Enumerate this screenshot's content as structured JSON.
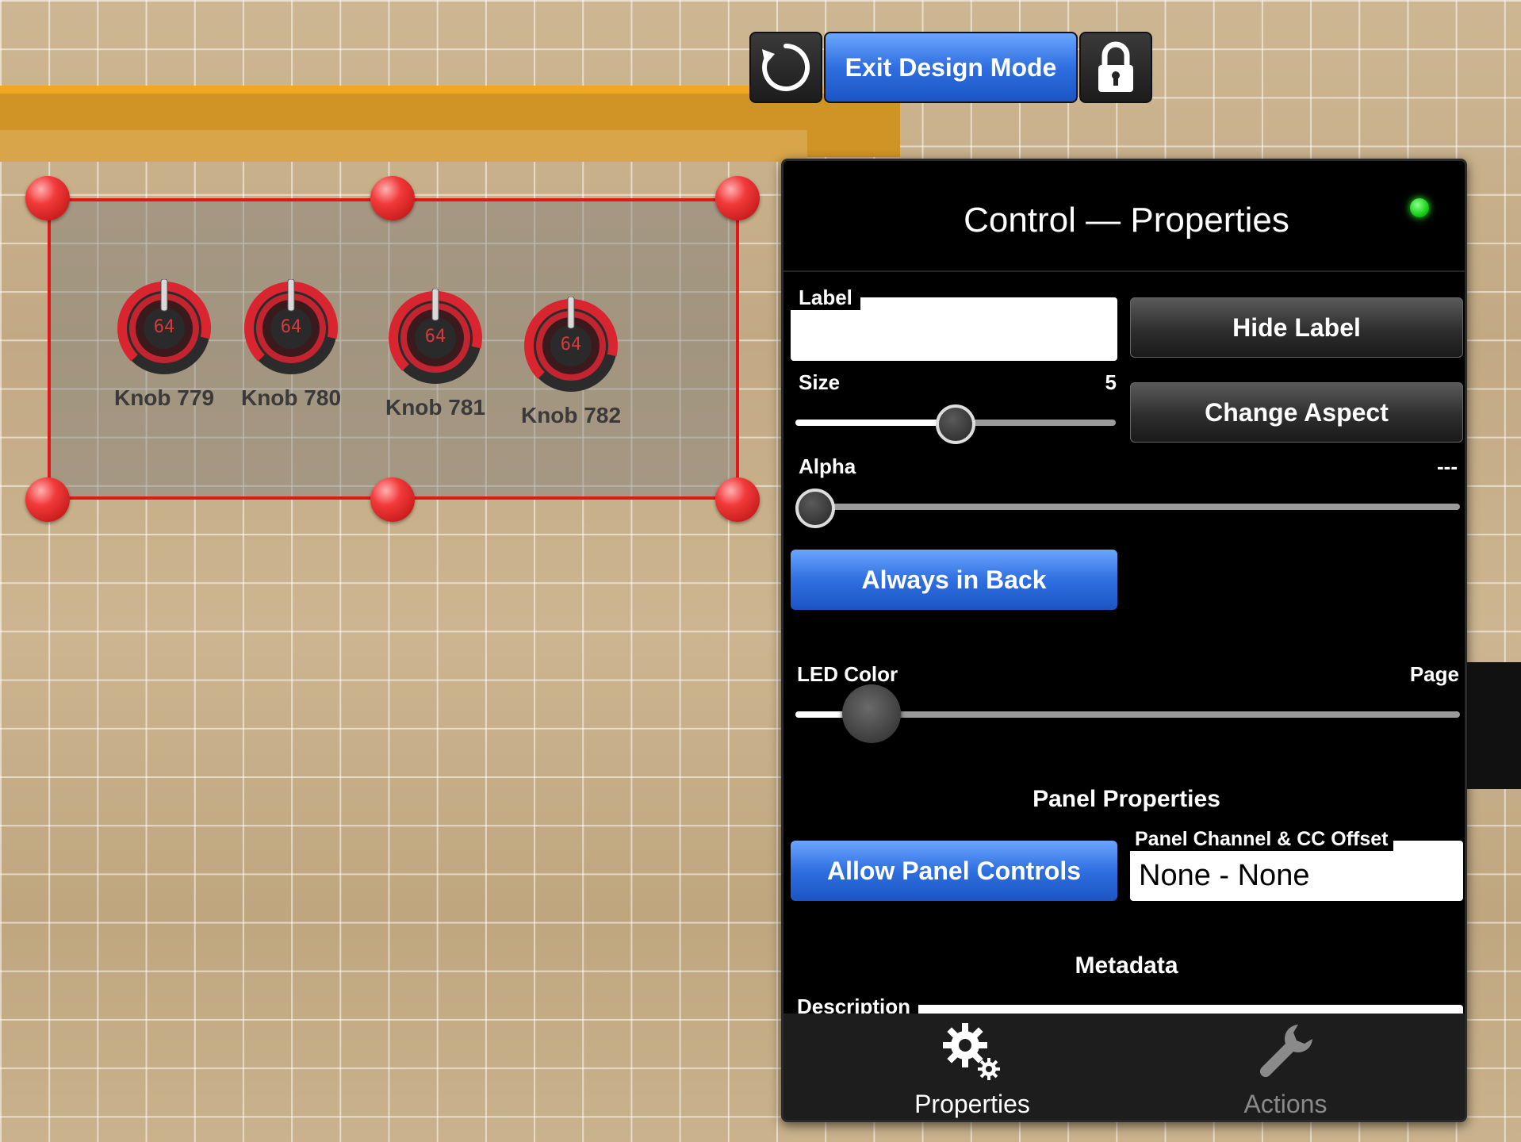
{
  "toolbar": {
    "refresh_icon": "refresh-icon",
    "exit_label": "Exit Design Mode",
    "lock_icon": "lock-icon"
  },
  "knobs": [
    {
      "label": "Knob 779",
      "value": "64"
    },
    {
      "label": "Knob 780",
      "value": "64"
    },
    {
      "label": "Knob 781",
      "value": "64"
    },
    {
      "label": "Knob 782",
      "value": "64"
    }
  ],
  "panel": {
    "title": "Control — Properties",
    "status_led_color": "#1ed51e",
    "label_field": {
      "label": "Label",
      "value": ""
    },
    "hide_label_button": "Hide Label",
    "size": {
      "label": "Size",
      "value": "5",
      "fraction": 0.5
    },
    "change_aspect_button": "Change Aspect",
    "alpha": {
      "label": "Alpha",
      "value": "---",
      "fraction": 0.0
    },
    "always_in_back_button": "Always in Back",
    "led_color": {
      "label": "LED Color",
      "right_label": "Page",
      "fraction": 0.08
    },
    "panel_properties": {
      "heading": "Panel Properties",
      "allow_panel_controls_button": "Allow Panel Controls",
      "channel_offset_label": "Panel Channel & CC Offset",
      "channel_offset_value": "None - None"
    },
    "metadata": {
      "heading": "Metadata",
      "description_label": "Description"
    },
    "tabs": [
      {
        "label": "Properties",
        "icon": "gears-icon",
        "active": true
      },
      {
        "label": "Actions",
        "icon": "wrench-icon",
        "active": false
      }
    ]
  },
  "colors": {
    "accent_blue": "#2f6fe0",
    "selection_red": "#e01818",
    "knob_red": "#d8252f"
  }
}
